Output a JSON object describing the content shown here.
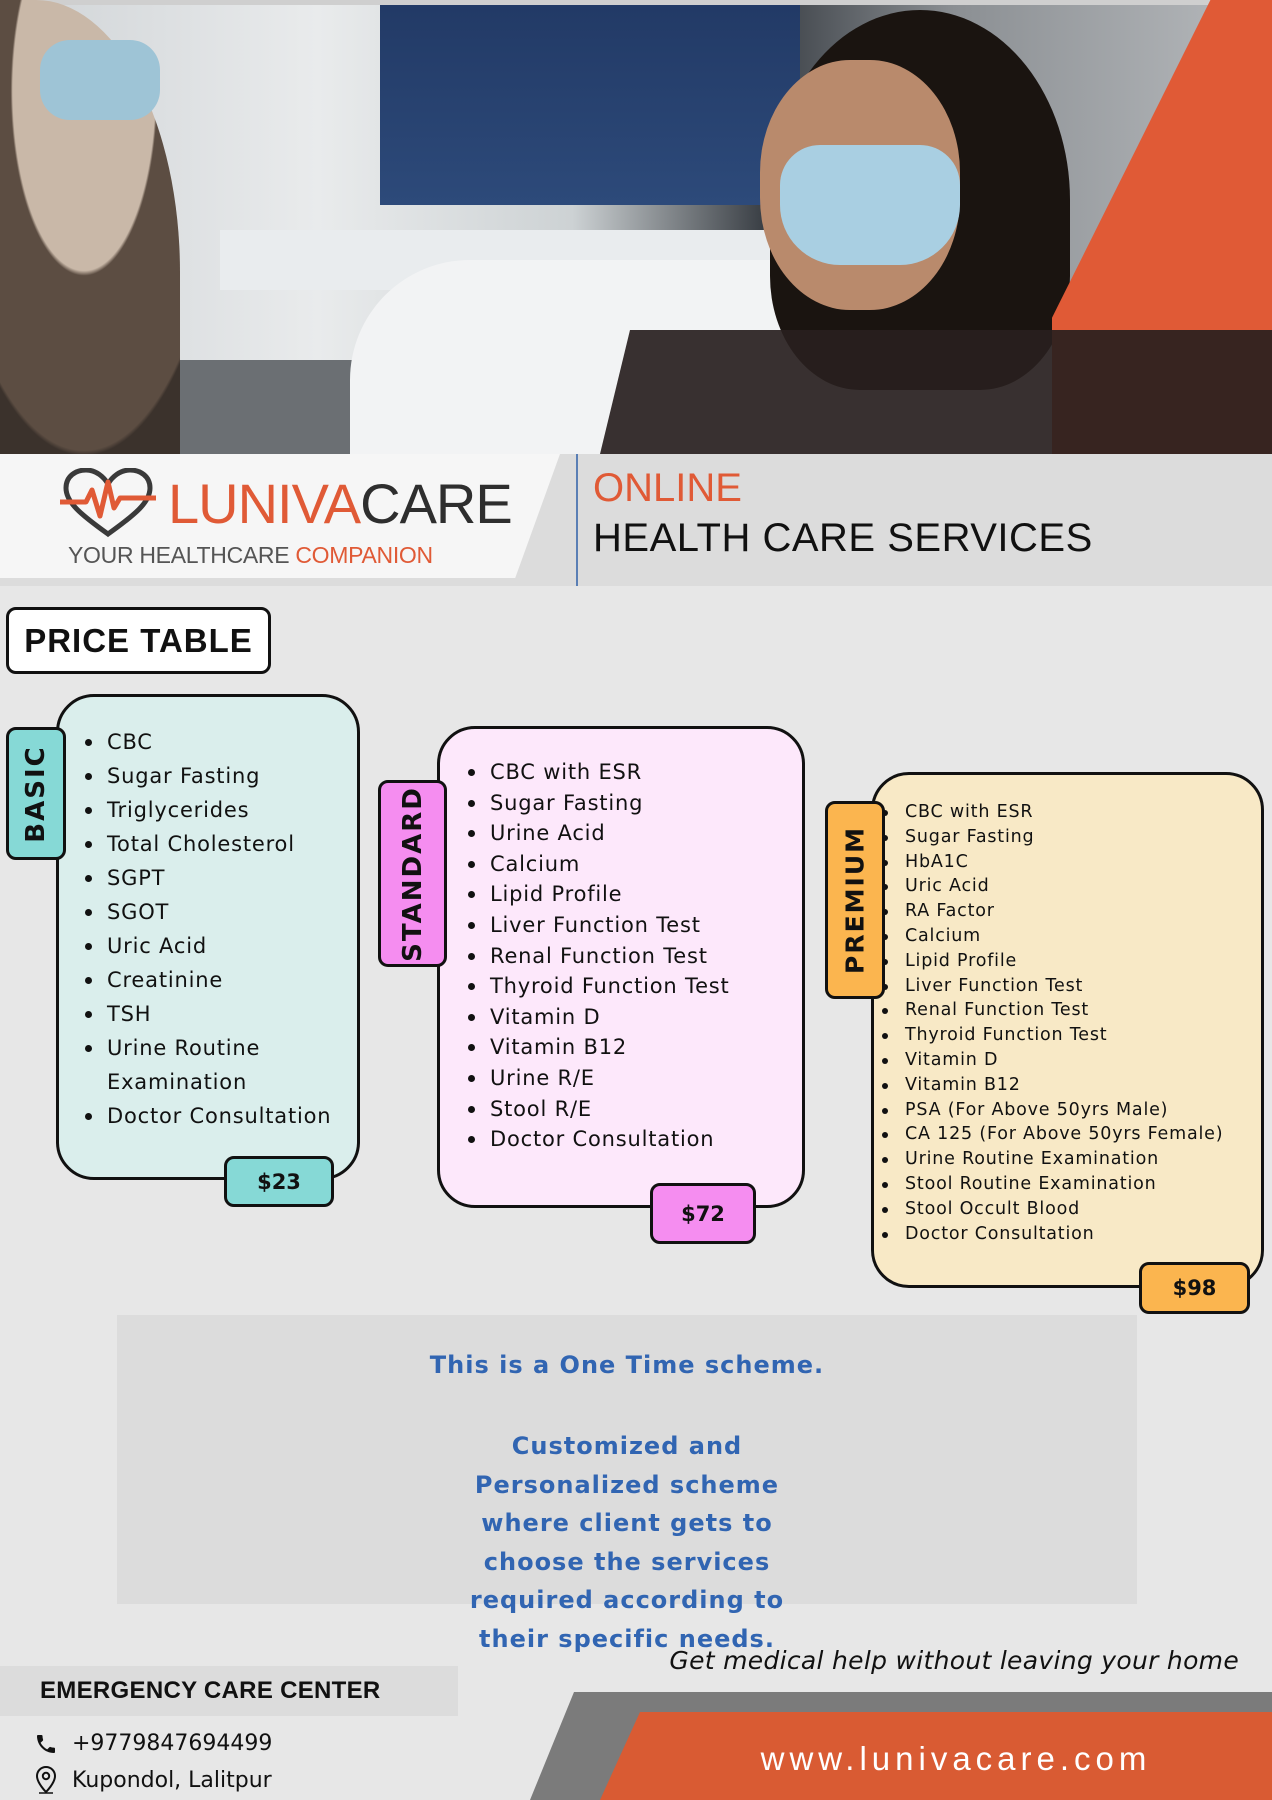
{
  "brand": {
    "logo_luniva": "LUNIVA",
    "logo_care": "CARE",
    "tagline_main": "YOUR HEALTHCARE ",
    "tagline_accent": "COMPANION",
    "headline_top": "ONLINE",
    "headline_bottom": "HEALTH CARE SERVICES",
    "accent_color": "#e05a36"
  },
  "price_table": {
    "title": "PRICE TABLE",
    "plans": [
      {
        "name": "BASIC",
        "price": "$23",
        "color": "#86d9d6",
        "items": [
          "CBC",
          "Sugar Fasting",
          "Triglycerides",
          "Total Cholesterol",
          "SGPT",
          "SGOT",
          "Uric Acid",
          "Creatinine",
          "TSH",
          "Urine Routine Examination",
          "Doctor Consultation"
        ]
      },
      {
        "name": "STANDARD",
        "price": "$72",
        "color": "#f58df0",
        "items": [
          "CBC with ESR",
          "Sugar Fasting",
          "Urine Acid",
          "Calcium",
          "Lipid Profile",
          "Liver Function Test",
          "Renal Function Test",
          "Thyroid Function Test",
          "Vitamin D",
          "Vitamin B12",
          "Urine R/E",
          "Stool R/E",
          "Doctor Consultation"
        ]
      },
      {
        "name": "PREMIUM",
        "price": "$98",
        "color": "#fbb54f",
        "items": [
          "CBC with ESR",
          "Sugar Fasting",
          "HbA1C",
          "Uric Acid",
          "RA Factor",
          "Calcium",
          "Lipid Profile",
          "Liver Function Test",
          "Renal Function Test",
          "Thyroid Function Test",
          "Vitamin D",
          "Vitamin B12",
          "PSA (For Above 50yrs Male)",
          "CA 125 (For Above 50yrs Female)",
          "Urine Routine Examination",
          "Stool Routine Examination",
          "Stool Occult Blood",
          "Doctor Consultation"
        ]
      }
    ]
  },
  "note": {
    "line1": "This is a One Time scheme.",
    "line2": "Customized and Personalized scheme where client gets to choose the services required according to their specific needs."
  },
  "footer": {
    "slogan": "Get medical help without leaving your home",
    "center_title": "EMERGENCY CARE CENTER",
    "phone": "+9779847694499",
    "address": "Kupondol, Lalitpur",
    "website": "www.lunivacare.com"
  }
}
